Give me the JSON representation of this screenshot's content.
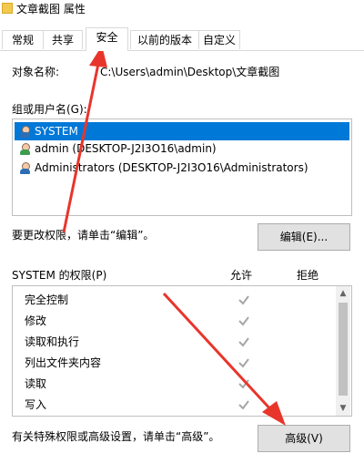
{
  "window": {
    "title": "文章截图 属性"
  },
  "tabs": [
    {
      "label": "常规"
    },
    {
      "label": "共享"
    },
    {
      "label": "安全"
    },
    {
      "label": "以前的版本"
    },
    {
      "label": "自定义"
    }
  ],
  "object": {
    "label": "对象名称:",
    "value": "C:\\Users\\admin\\Desktop\\文章截图"
  },
  "groups": {
    "label": "组或用户名(G):",
    "items": [
      {
        "label": "SYSTEM",
        "selected": true
      },
      {
        "label": "admin (DESKTOP-J2I3O16\\admin)",
        "selected": false
      },
      {
        "label": "Administrators (DESKTOP-J2I3O16\\Administrators)",
        "selected": false
      }
    ]
  },
  "edit": {
    "hint": "要更改权限，请单击“编辑”。",
    "button": "编辑(E)..."
  },
  "permissions": {
    "header": "SYSTEM 的权限(P)",
    "allow": "允许",
    "deny": "拒绝",
    "rows": [
      {
        "label": "完全控制",
        "allow": true,
        "deny": false
      },
      {
        "label": "修改",
        "allow": true,
        "deny": false
      },
      {
        "label": "读取和执行",
        "allow": true,
        "deny": false
      },
      {
        "label": "列出文件夹内容",
        "allow": true,
        "deny": false
      },
      {
        "label": "读取",
        "allow": true,
        "deny": false
      },
      {
        "label": "写入",
        "allow": true,
        "deny": false
      }
    ]
  },
  "advanced": {
    "hint": "有关特殊权限或高级设置，请单击“高级”。",
    "button": "高级(V)"
  },
  "colors": {
    "selection": "#0078d7",
    "annotation_arrow": "#e8352b",
    "check": "#a6a6a6"
  }
}
